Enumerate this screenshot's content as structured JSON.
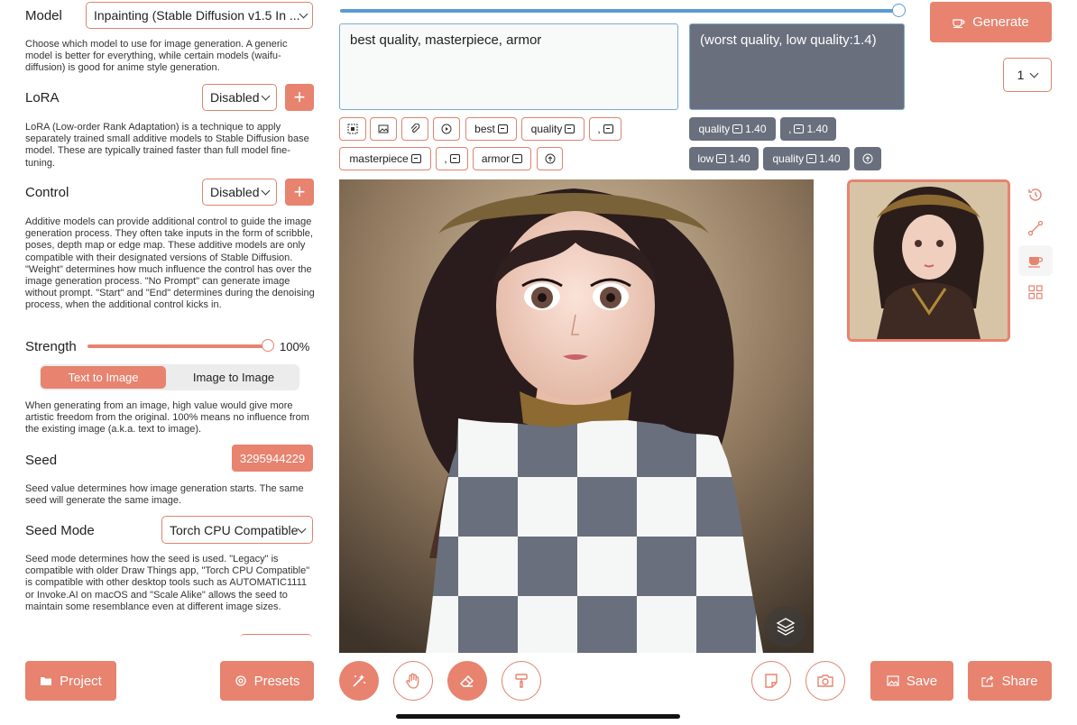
{
  "left": {
    "model": {
      "label": "Model",
      "value": "Inpainting (Stable Diffusion v1.5 In ...",
      "desc": "Choose which model to use for image generation. A generic model is better for everything, while certain models (waifu-diffusion) is good for anime style generation."
    },
    "lora": {
      "label": "LoRA",
      "value": "Disabled",
      "add": "+",
      "desc": "LoRA (Low-order Rank Adaptation) is a technique to apply separately trained small additive models to Stable Diffusion base model. These are typically trained faster than full model fine-tuning."
    },
    "control": {
      "label": "Control",
      "value": "Disabled",
      "add": "+",
      "desc": "Additive models can provide additional control to guide the image generation process. They often take inputs in the form of scribble, poses, depth map or edge map. These additive models are only compatible with their designated versions of Stable Diffusion. \"Weight\" determines how much influence the control has over the image generation process. \"No Prompt\" can generate image without prompt. \"Start\" and \"End\" determines during the denoising process, when the additional control kicks in."
    },
    "strength": {
      "label": "Strength",
      "value": "100%",
      "level": 1.0,
      "desc": "When generating from an image, high value would give more artistic freedom from the original. 100% means no influence from the existing image (a.k.a. text to image)."
    },
    "mode_tabs": [
      "Text to Image",
      "Image to Image"
    ],
    "seed": {
      "label": "Seed",
      "value": "3295944229",
      "desc": "Seed value determines how image generation starts. The same seed will generate the same image."
    },
    "seed_mode": {
      "label": "Seed Mode",
      "value": "Torch CPU Compatible",
      "desc": "Seed mode determines how the seed is used. \"Legacy\" is compatible with older Draw Things app, \"Torch CPU Compatible\" is compatible with other desktop tools such as AUTOMATIC1111 or Invoke.AI on macOS and \"Scale Alike\" allows the seed to maintain some resemblance even at different image sizes."
    },
    "project_btn": "Project",
    "presets_btn": "Presets"
  },
  "prompt": {
    "positive": "best quality, masterpiece, armor",
    "negative": "(worst quality, low quality:1.4)",
    "progress": 1.0,
    "pos_chips": [
      "best",
      "quality",
      ",",
      "masterpiece",
      ",",
      "armor"
    ],
    "neg_chips": [
      {
        "text": "quality",
        "weight": "1.40"
      },
      {
        "text": ",",
        "weight": "1.40"
      },
      {
        "text": "low",
        "weight": "1.40"
      },
      {
        "text": "quality",
        "weight": "1.40"
      }
    ]
  },
  "generate": {
    "label": "Generate",
    "count": "1"
  },
  "bottom": {
    "save": "Save",
    "share": "Share"
  },
  "colors": {
    "accent": "#e7836f",
    "dark": "#6a6f7d"
  }
}
